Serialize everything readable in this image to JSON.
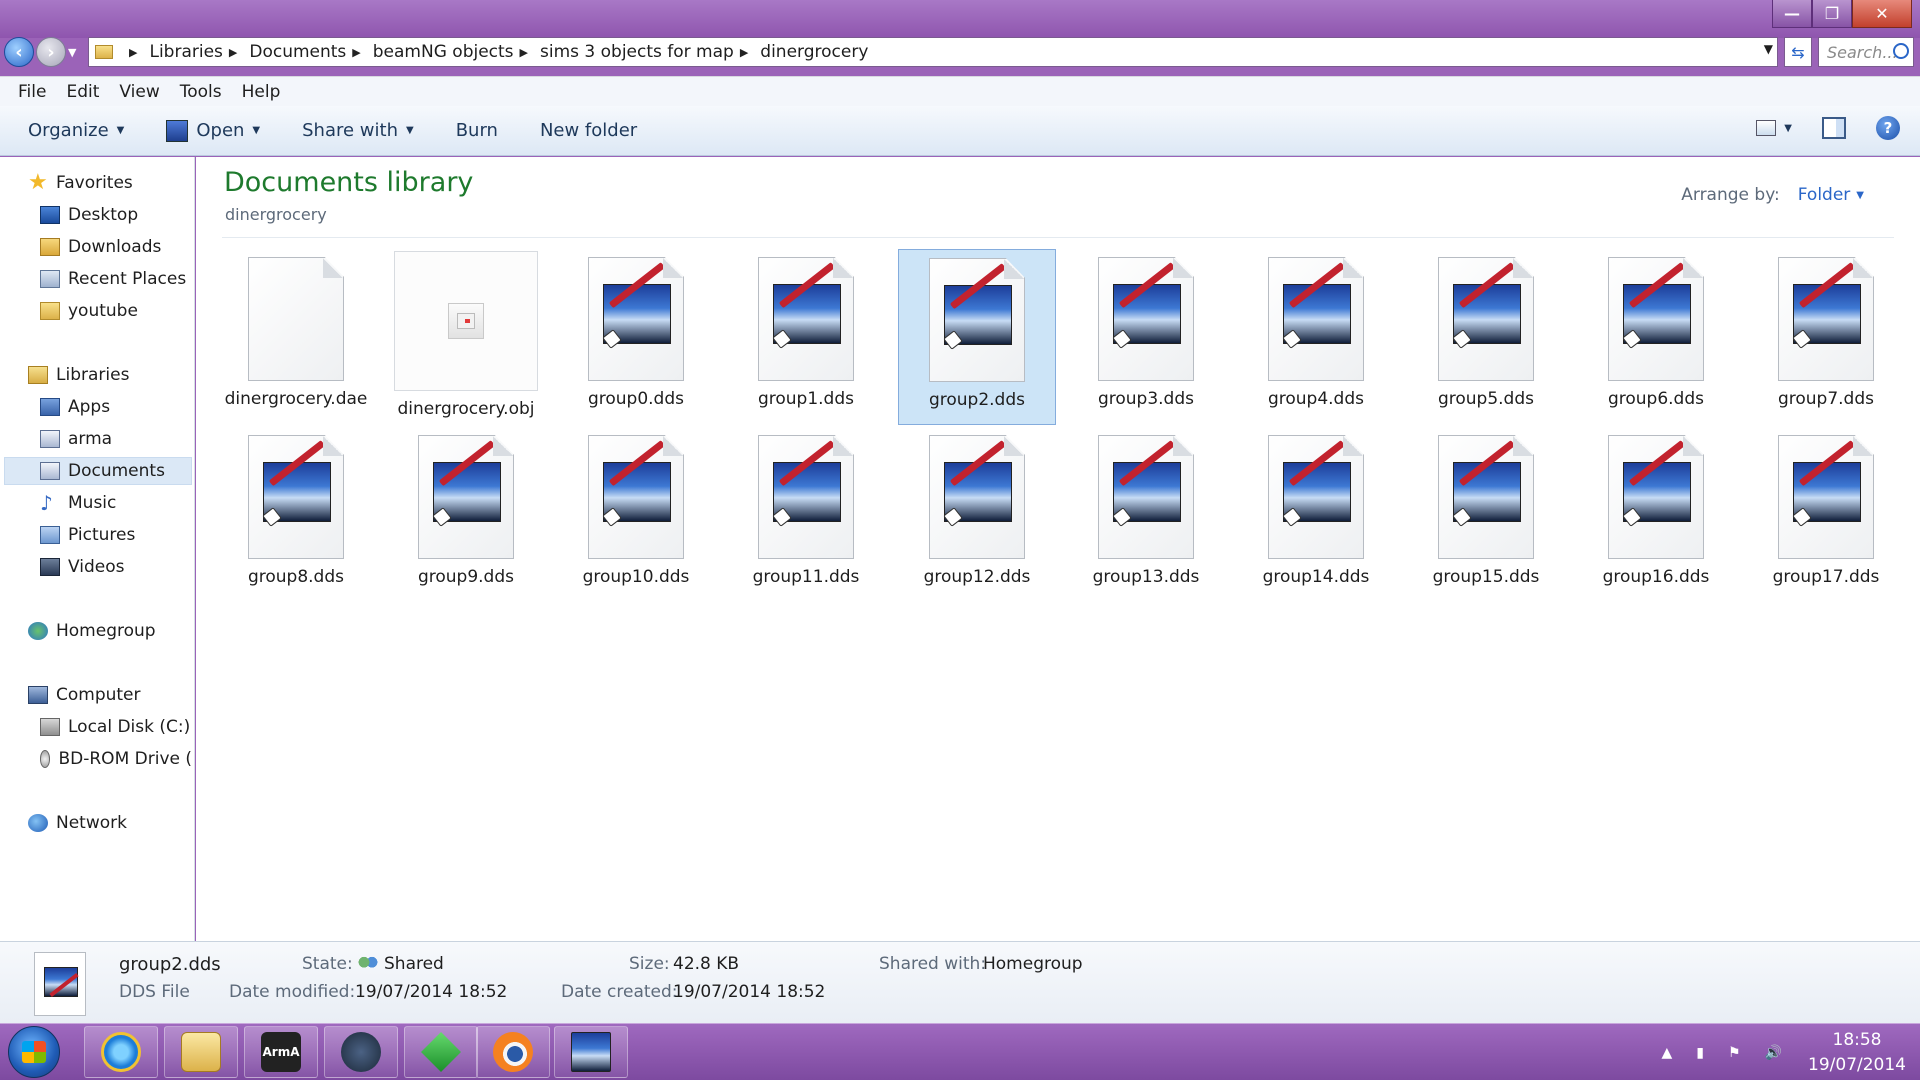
{
  "window": {
    "minimize": "—",
    "maximize": "❐",
    "close": "✕"
  },
  "breadcrumb": [
    "Libraries",
    "Documents",
    "beamNG objects",
    "sims 3 objects for map",
    "dinergrocery"
  ],
  "search": {
    "placeholder": "Search..."
  },
  "menu": [
    "File",
    "Edit",
    "View",
    "Tools",
    "Help"
  ],
  "toolbar": {
    "organize": "Organize",
    "open": "Open",
    "share_with": "Share with",
    "burn": "Burn",
    "new_folder": "New folder"
  },
  "sidebar": {
    "favorites": "Favorites",
    "desktop": "Desktop",
    "downloads": "Downloads",
    "recent_places": "Recent Places",
    "youtube": "youtube",
    "libraries": "Libraries",
    "apps": "Apps",
    "arma": "arma",
    "documents": "Documents",
    "music": "Music",
    "pictures": "Pictures",
    "videos": "Videos",
    "homegroup": "Homegroup",
    "computer": "Computer",
    "local_disk": "Local Disk (C:)",
    "bd_rom": "BD-ROM Drive (",
    "network": "Network"
  },
  "content": {
    "title": "Documents library",
    "subtitle": "dinergrocery",
    "arrange_label": "Arrange by:",
    "arrange_value": "Folder",
    "files": [
      "dinergrocery.dae",
      "dinergrocery.obj",
      "group0.dds",
      "group1.dds",
      "group2.dds",
      "group3.dds",
      "group4.dds",
      "group5.dds",
      "group6.dds",
      "group7.dds",
      "group8.dds",
      "group9.dds",
      "group10.dds",
      "group11.dds",
      "group12.dds",
      "group13.dds",
      "group14.dds",
      "group15.dds",
      "group16.dds",
      "group17.dds"
    ],
    "selected_file": "group2.dds"
  },
  "details": {
    "name": "group2.dds",
    "type": "DDS File",
    "state_label": "State:",
    "state_value": "Shared",
    "modified_label": "Date modified:",
    "modified_value": "19/07/2014 18:52",
    "size_label": "Size:",
    "size_value": "42.8 KB",
    "created_label": "Date created:",
    "created_value": "19/07/2014 18:52",
    "shared_label": "Shared with:",
    "shared_value": "Homegroup"
  },
  "taskbar": {
    "arma_label": "ArmA",
    "time": "18:58",
    "date": "19/07/2014"
  }
}
